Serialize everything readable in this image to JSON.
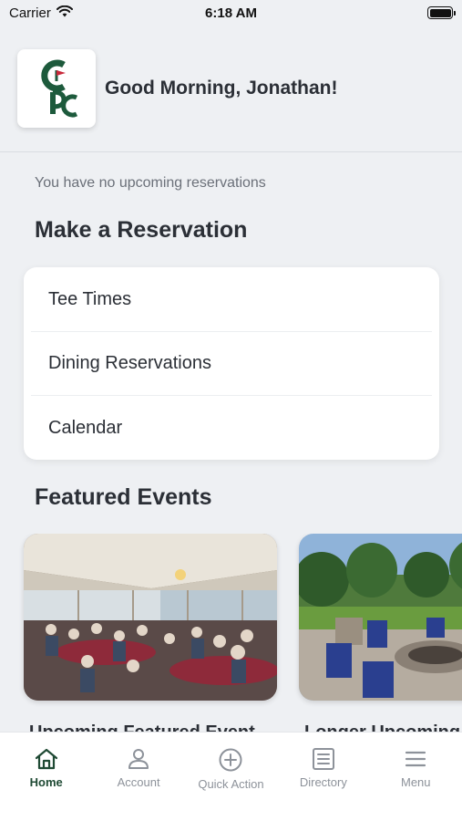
{
  "status_bar": {
    "carrier": "Carrier",
    "time": "6:18 AM"
  },
  "header": {
    "logo_text": "GPC",
    "greeting": "Good Morning, Jonathan!"
  },
  "reservations": {
    "empty_message": "You have no upcoming reservations",
    "title": "Make a Reservation",
    "items": [
      {
        "label": "Tee Times"
      },
      {
        "label": "Dining Reservations"
      },
      {
        "label": "Calendar"
      }
    ]
  },
  "events": {
    "title": "Featured Events",
    "cards": [
      {
        "title": "Upcoming Featured Event"
      },
      {
        "title": "Longer Upcoming"
      }
    ]
  },
  "tab_bar": {
    "tabs": [
      {
        "label": "Home",
        "icon": "home-icon",
        "active": true
      },
      {
        "label": "Account",
        "icon": "person-icon",
        "active": false
      },
      {
        "label": "Quick Action",
        "icon": "plus-circle-icon",
        "active": false
      },
      {
        "label": "Directory",
        "icon": "list-icon",
        "active": false
      },
      {
        "label": "Menu",
        "icon": "menu-icon",
        "active": false
      }
    ]
  },
  "colors": {
    "accent": "#1f4a34",
    "background": "#eef0f3",
    "logo_green": "#1d5a3c",
    "logo_red": "#c8283a"
  }
}
